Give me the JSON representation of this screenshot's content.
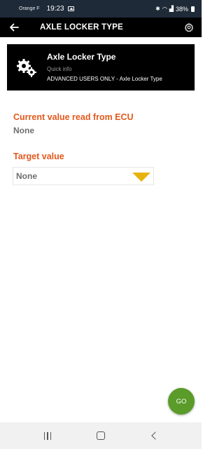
{
  "status_bar": {
    "carrier": "Orange F",
    "time": "19:23",
    "battery": "38%"
  },
  "app_bar": {
    "title": "AXLE LOCKER TYPE",
    "back_icon": "arrow-left-icon",
    "settings_icon": "gear-icon"
  },
  "info_card": {
    "icon": "gears-icon",
    "title": "Axle Locker Type",
    "subtitle": "Quick info",
    "description": "ADVANCED USERS ONLY - Axle Locker Type"
  },
  "current": {
    "label": "Current value read from ECU",
    "value": "None"
  },
  "target": {
    "label": "Target value",
    "selected": "None"
  },
  "go_button": {
    "label": "GO"
  },
  "colors": {
    "accent": "#e4581c",
    "dropdown_arrow": "#e8b20e",
    "go_button": "#5a9b2a"
  }
}
